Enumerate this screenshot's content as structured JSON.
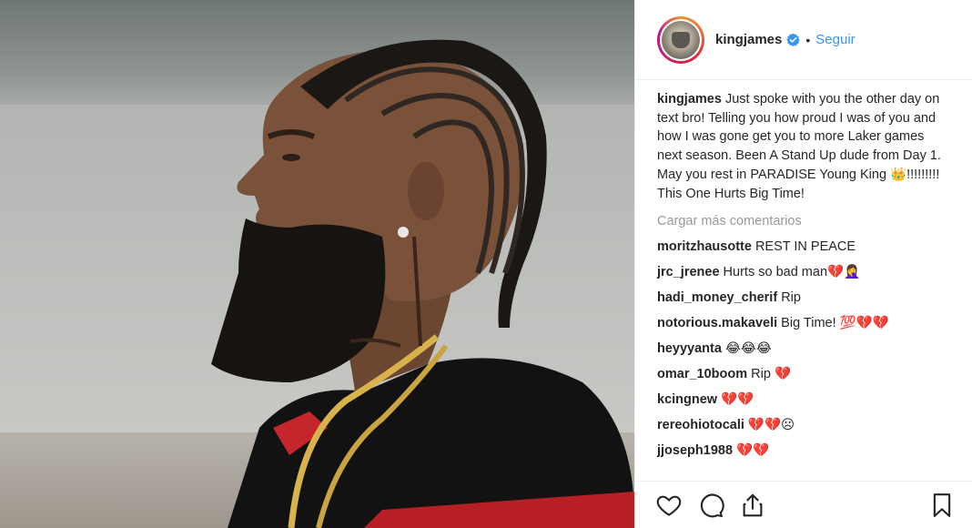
{
  "header": {
    "username": "kingjames",
    "separator": "•",
    "follow_label": "Seguir"
  },
  "caption": {
    "username": "kingjames",
    "text": " Just spoke with you the other day on text bro! Telling you how proud I was of you and how I was gone get you to more Laker games next season. Been A Stand Up dude from Day 1. May you rest in PARADISE Young King 👑!!!!!!!!! This One Hurts Big Time!"
  },
  "load_more_label": "Cargar más comentarios",
  "comments": [
    {
      "user": "moritzhausotte",
      "text": " REST IN PEACE"
    },
    {
      "user": "jrc_jrenee",
      "text": " Hurts so bad man💔🤦‍♀"
    },
    {
      "user": "hadi_money_cherif",
      "text": " Rip"
    },
    {
      "user": "notorious.makaveli",
      "text": " Big Time! 💯💔💔"
    },
    {
      "user": "heyyyanta",
      "text": " 😂😂😂"
    },
    {
      "user": "omar_10boom",
      "text": " Rip 💔"
    },
    {
      "user": "kcingnew",
      "text": " 💔💔"
    },
    {
      "user": "rereohiotocali",
      "text": " 💔💔☹"
    },
    {
      "user": "jjoseph1988",
      "text": " 💔💔"
    }
  ],
  "icons": {
    "verified": "verified-badge-icon",
    "like": "heart-icon",
    "comment": "comment-icon",
    "share": "share-icon",
    "save": "bookmark-icon"
  },
  "colors": {
    "follow": "#3897f0",
    "verified": "#3897f0",
    "muted": "#999999",
    "border": "#efefef"
  }
}
